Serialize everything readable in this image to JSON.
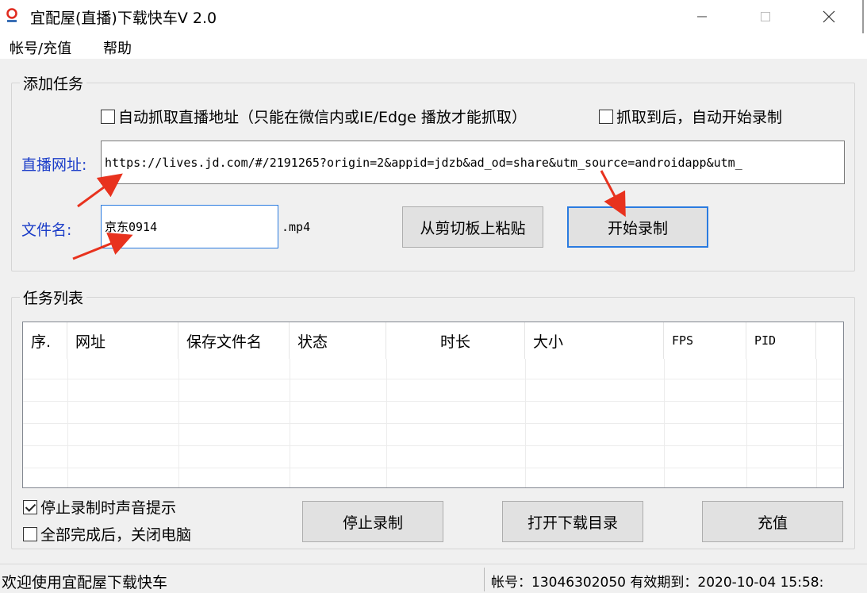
{
  "window": {
    "title": "宜配屋(直播)下载快车V 2.0",
    "min_glyph": "—",
    "max_glyph": "☐",
    "close_glyph": "✕"
  },
  "menu": {
    "items": [
      "帐号/充值",
      "帮助"
    ]
  },
  "add_task": {
    "group_title": "添加任务",
    "auto_capture_label": "自动抓取直播地址（只能在微信内或IE/Edge 播放才能抓取）",
    "auto_capture_checked": false,
    "auto_start_label": "抓取到后，自动开始录制",
    "auto_start_checked": false,
    "url_label": "直播网址:",
    "url_value": "https://lives.jd.com/#/2191265?origin=2&appid=jdzb&ad_od=share&utm_source=androidapp&utm_",
    "filename_label": "文件名:",
    "filename_value": "京东0914",
    "filename_suffix": ".mp4",
    "paste_button": "从剪切板上粘贴",
    "start_button": "开始录制"
  },
  "task_list": {
    "group_title": "任务列表",
    "columns": [
      "序.",
      "网址",
      "保存文件名",
      "状态",
      "时长",
      "大小",
      "FPS",
      "PID"
    ]
  },
  "options": {
    "sound_label": "停止录制时声音提示",
    "sound_checked": true,
    "shutdown_label": "全部完成后，关闭电脑",
    "shutdown_checked": false
  },
  "buttons": {
    "stop": "停止录制",
    "open_dir": "打开下载目录",
    "recharge": "充值"
  },
  "status": {
    "left": "欢迎使用宜配屋下载快车",
    "right": "帐号：13046302050 有效期到：2020-10-04 15:58:"
  },
  "colors": {
    "accent_blue": "#2a7be0",
    "label_blue": "#1a3cc8",
    "arrow_red": "#e8321e"
  }
}
